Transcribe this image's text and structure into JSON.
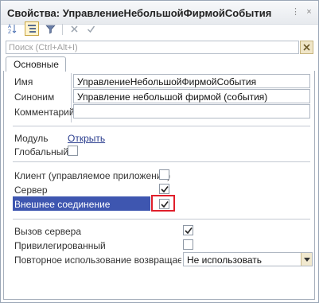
{
  "window": {
    "title": "Свойства: УправлениеНебольшойФирмойСобытия",
    "controls": {
      "menu": "⋮",
      "close": "×"
    }
  },
  "search": {
    "placeholder": "Поиск (Ctrl+Alt+I)"
  },
  "tabs": [
    {
      "label": "Основные"
    }
  ],
  "fields": {
    "name": {
      "label": "Имя",
      "value": "УправлениеНебольшойФирмойСобытия"
    },
    "synonym": {
      "label": "Синоним",
      "value": "Управление небольшой фирмой (события)"
    },
    "comment": {
      "label": "Комментарий",
      "value": ""
    }
  },
  "module": {
    "label": "Модуль",
    "link": "Открыть"
  },
  "global": {
    "label": "Глобальный",
    "checked": false
  },
  "client": {
    "label": "Клиент (управляемое приложение)",
    "checked": false
  },
  "server": {
    "label": "Сервер",
    "checked": true
  },
  "external": {
    "label": "Внешнее соединение",
    "checked": true
  },
  "server_call": {
    "label": "Вызов сервера",
    "checked": true
  },
  "privileged": {
    "label": "Привилегированный",
    "checked": false
  },
  "reuse": {
    "label": "Повторное использование возвращаемых значений",
    "value": "Не использовать"
  },
  "colors": {
    "highlight": "#3e56b0",
    "red_marker": "#e01f2b",
    "check": "#222222"
  }
}
